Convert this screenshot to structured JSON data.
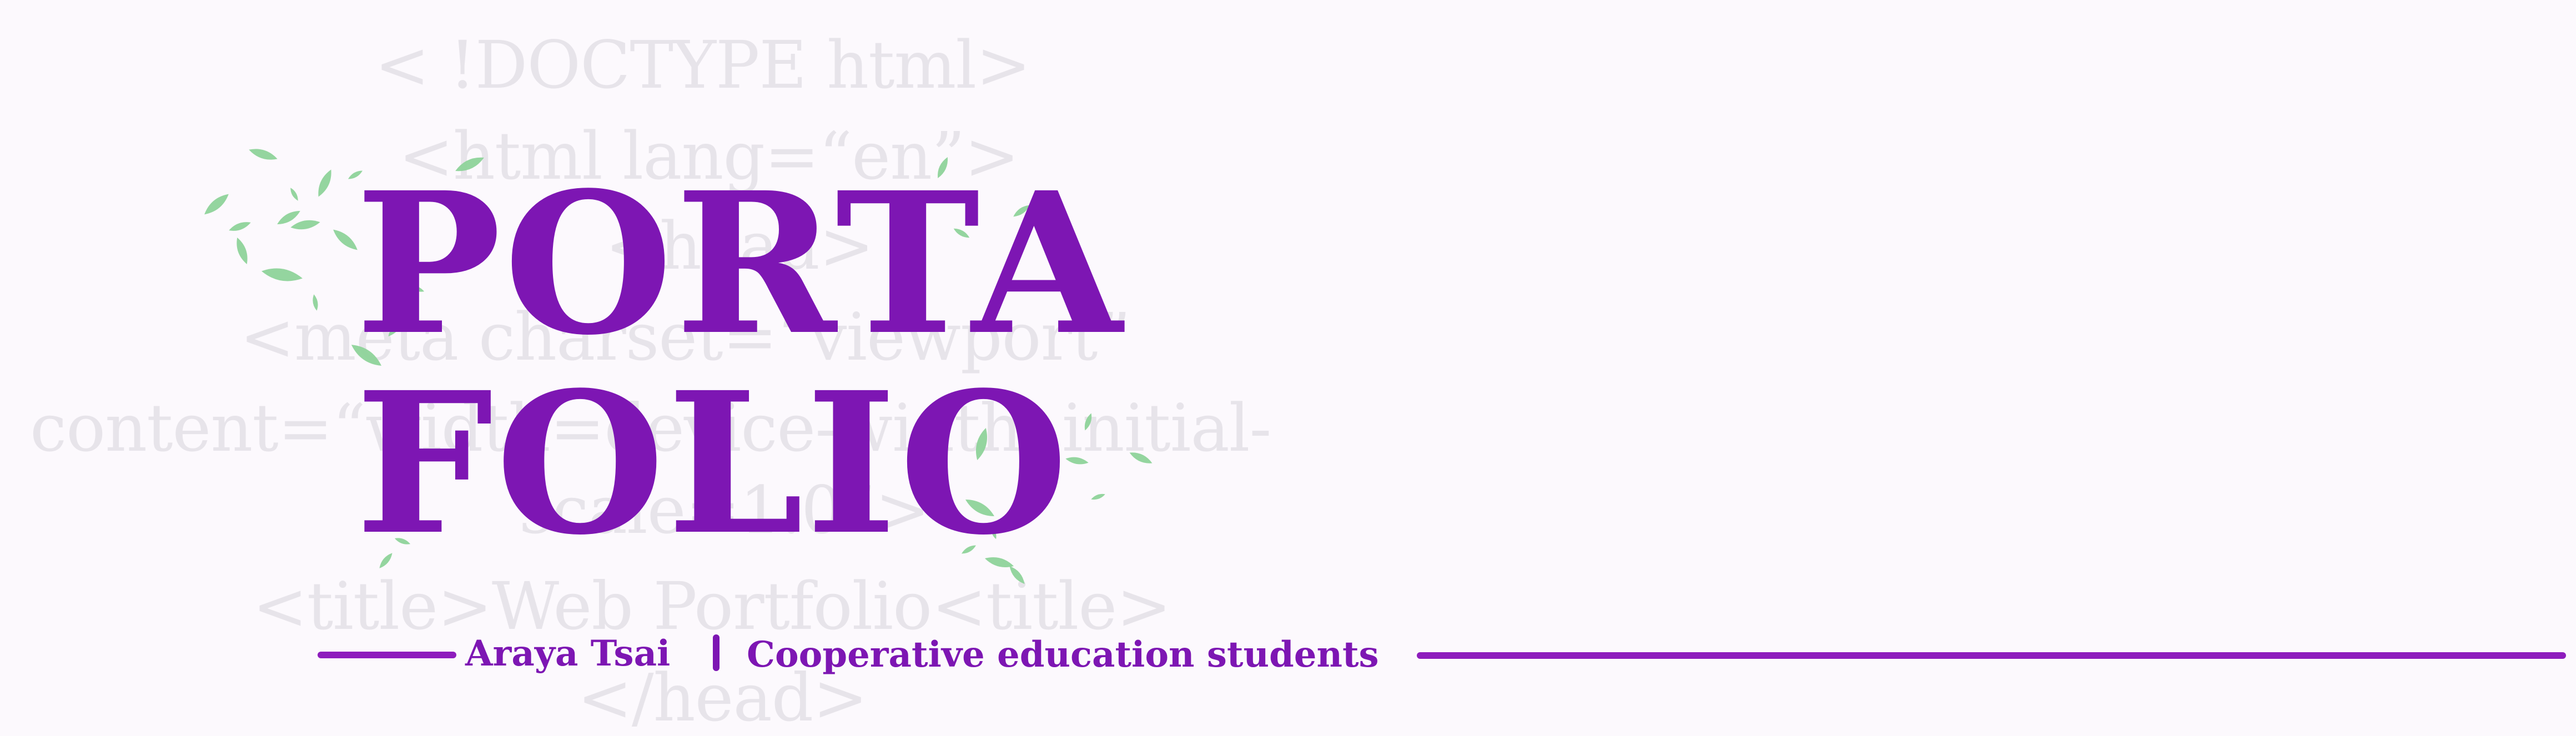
{
  "background_code": [
    "< !DOCTYPE html>",
    "<html lang=“en”>",
    "<head>",
    "<meta charset=“viewport”",
    "content=“width=device-width, initial-",
    "scale=1.0”>",
    "<title>Web Portfolio<title>",
    "</head>"
  ],
  "title": {
    "line1": "PORTA",
    "line2": "FOLIO"
  },
  "byline": {
    "author": "Araya Tsai",
    "role": "Cooperative education students"
  },
  "colors": {
    "accent": "#7d16b3",
    "rule": "#8e1dbd",
    "code_text": "#e7e4ea",
    "leaf": "#8fd39a",
    "background": "#fcf9fd"
  },
  "decorations": [
    "leaf-cluster-top-left",
    "leaf-cluster-bottom-right"
  ]
}
